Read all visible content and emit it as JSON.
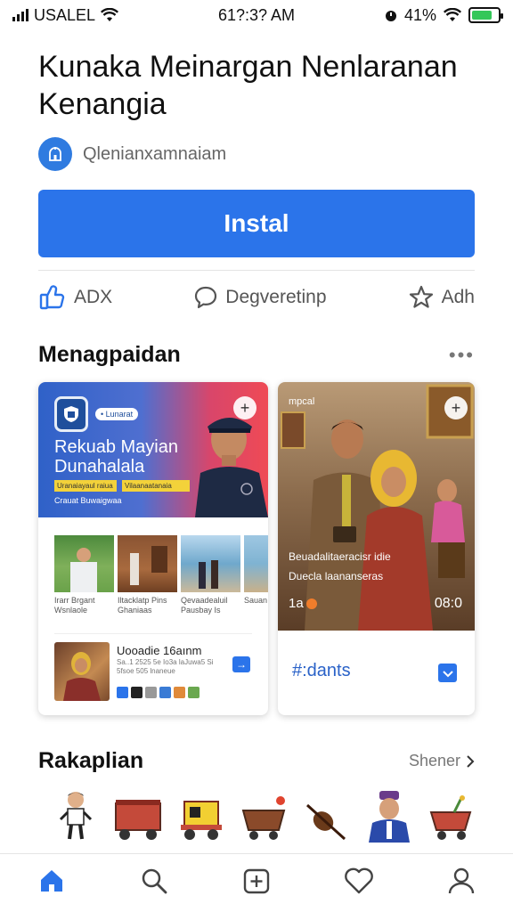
{
  "status_bar": {
    "carrier": "USALEL",
    "time": "61?:3? AM",
    "battery_percent": "41%"
  },
  "app": {
    "title": "Kunaka Meinargan Nenlaranan Kenangia",
    "developer": "Qlenianxamnaiam",
    "install_label": "Instal"
  },
  "actions": [
    {
      "icon": "thumbs-up-icon",
      "label": "ADX"
    },
    {
      "icon": "chat-bubble-icon",
      "label": "Degveretinp"
    },
    {
      "icon": "star-icon",
      "label": "Adh"
    }
  ],
  "section_main": {
    "title": "Menagpaidan",
    "more": "•••"
  },
  "card_1": {
    "banner_tag": "• Lunarat",
    "banner_heading": "Rekuab Mayian Dunahalala",
    "chip_1": "Uranaiayaul raiua",
    "chip_2": "Vilaanaatanaia",
    "banner_caption": "Crauat Buwaigwaa",
    "thumbs": [
      {
        "caption": "Irarr Brgant Wsnlaole"
      },
      {
        "caption": "Iltacklatp Pins Ghaniaas"
      },
      {
        "caption": "Qevaadealuil Pausbay Is"
      },
      {
        "caption": "Sauan Nlaan"
      }
    ],
    "promo_title": "Uooadie 16aınm",
    "promo_desc": "Sa..1 2525 5e Io3a laJuwa5 Si 5fsoe 505 lnaneue"
  },
  "card_2": {
    "brand": "mpcal",
    "title": "Beuadalitaeracisr idie",
    "subtitle": "Duecla laananseras",
    "count": "1a",
    "time": "08:0",
    "label": "#:dants"
  },
  "section_recs": {
    "title": "Rakaplian",
    "see_more": "Shener"
  },
  "recommendations": [
    {
      "icon": "person-figure-icon"
    },
    {
      "icon": "red-wagon-icon"
    },
    {
      "icon": "yellow-cart-icon"
    },
    {
      "icon": "basket-cart-icon"
    },
    {
      "icon": "lute-instrument-icon"
    },
    {
      "icon": "suited-man-icon"
    },
    {
      "icon": "flower-cart-icon"
    }
  ],
  "bottom_nav": [
    {
      "icon": "home-icon",
      "active": true
    },
    {
      "icon": "search-icon",
      "active": false
    },
    {
      "icon": "add-square-icon",
      "active": false
    },
    {
      "icon": "heart-icon",
      "active": false
    },
    {
      "icon": "profile-icon",
      "active": false
    }
  ],
  "colors": {
    "accent": "#2b74ea",
    "battery": "#34c759"
  }
}
